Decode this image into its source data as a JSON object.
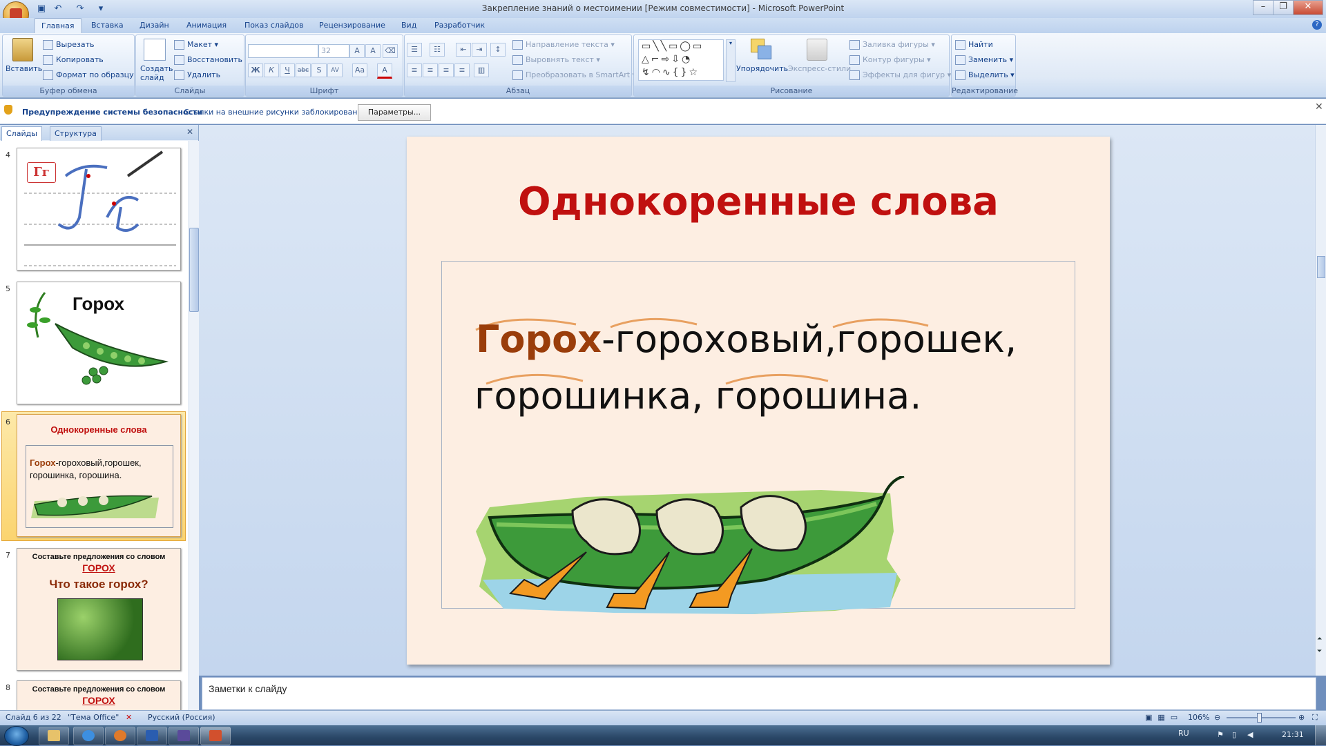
{
  "window": {
    "title": "Закрепление знаний о местоимении [Режим совместимости] - Microsoft PowerPoint",
    "qat": [
      "save-icon",
      "undo-icon",
      "redo-icon"
    ]
  },
  "tabs": [
    "Главная",
    "Вставка",
    "Дизайн",
    "Анимация",
    "Показ слайдов",
    "Рецензирование",
    "Вид",
    "Разработчик"
  ],
  "ribbon": {
    "clipboard": {
      "label": "Буфер обмена",
      "paste": "Вставить",
      "cut": "Вырезать",
      "copy": "Копировать",
      "format_painter": "Формат по образцу"
    },
    "slides": {
      "label": "Слайды",
      "new_slide": "Создать слайд",
      "layout": "Макет",
      "reset": "Восстановить",
      "delete": "Удалить"
    },
    "font": {
      "label": "Шрифт",
      "size": "32",
      "bold": "Ж",
      "italic": "К",
      "underline": "Ч",
      "strike": "abc",
      "shadow": "S",
      "spacing": "AV",
      "case": "Aa",
      "color": "A"
    },
    "paragraph": {
      "label": "Абзац",
      "text_direction": "Направление текста",
      "align_text": "Выровнять текст",
      "smartart": "Преобразовать в SmartArt"
    },
    "drawing": {
      "label": "Рисование",
      "arrange": "Упорядочить",
      "quick_styles": "Экспресс-стили",
      "fill": "Заливка фигуры",
      "outline": "Контур фигуры",
      "effects": "Эффекты для фигур"
    },
    "editing": {
      "label": "Редактирование",
      "find": "Найти",
      "replace": "Заменить",
      "select": "Выделить"
    }
  },
  "security": {
    "title": "Предупреждение системы безопасности",
    "text": "Ссылки на внешние рисунки заблокированы",
    "button": "Параметры..."
  },
  "left_pane": {
    "tabs": [
      "Слайды",
      "Структура"
    ],
    "thumbnails": [
      {
        "num": "4",
        "badge": "Гг"
      },
      {
        "num": "5",
        "word": "Горох"
      },
      {
        "num": "6",
        "title": "Однокоренные слова",
        "line1_root": "Горох",
        "line1_rest": "-гороховый,горошек,",
        "line2": "горошинка, горошина."
      },
      {
        "num": "7",
        "line1": "Составьте предложения со словом",
        "word": "ГОРОХ",
        "question": "Что такое горох?"
      },
      {
        "num": "8",
        "line1": "Составьте предложения со словом",
        "word": "ГОРОХ"
      }
    ]
  },
  "slide": {
    "title": "Однокоренные слова",
    "root_word": "Горох",
    "line1_rest": "-гороховый,горошек,",
    "line2": "горошинка, горошина."
  },
  "notes": {
    "placeholder": "Заметки к слайду"
  },
  "status": {
    "slide_info": "Слайд 6 из 22",
    "theme": "\"Тема Office\"",
    "language": "Русский (Россия)",
    "zoom": "106%"
  },
  "taskbar": {
    "lang": "RU",
    "time": "21:31"
  },
  "colors": {
    "title_red": "#c0100f",
    "root_brown": "#9a3d0a",
    "arc_orange": "#e8a060",
    "slide_bg": "#fdeee2"
  }
}
